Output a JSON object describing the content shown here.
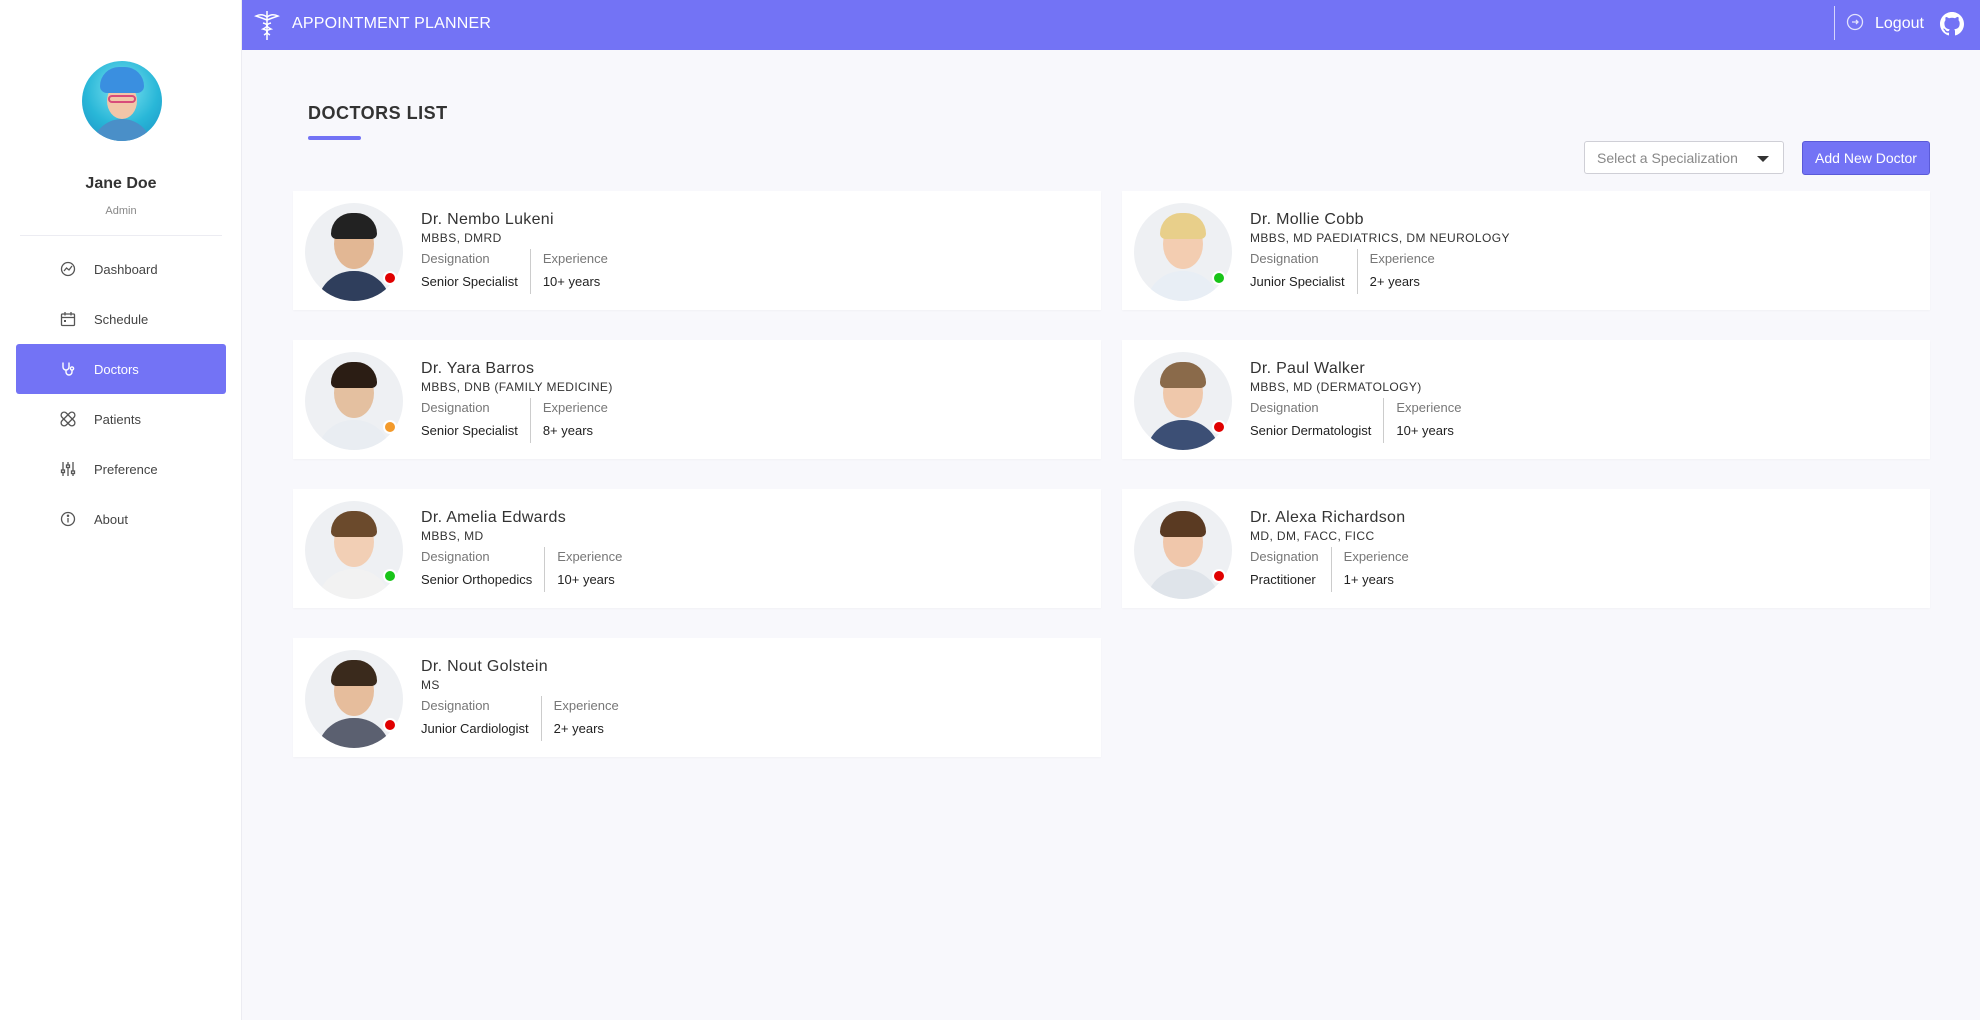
{
  "app": {
    "title": "APPOINTMENT PLANNER",
    "logout_label": "Logout"
  },
  "user": {
    "name": "Jane Doe",
    "role": "Admin"
  },
  "sidebar": {
    "items": [
      {
        "label": "Dashboard",
        "icon": "dashboard-icon",
        "active": false
      },
      {
        "label": "Schedule",
        "icon": "calendar-icon",
        "active": false
      },
      {
        "label": "Doctors",
        "icon": "stethoscope-icon",
        "active": true
      },
      {
        "label": "Patients",
        "icon": "bandage-icon",
        "active": false
      },
      {
        "label": "Preference",
        "icon": "sliders-icon",
        "active": false
      },
      {
        "label": "About",
        "icon": "info-icon",
        "active": false
      }
    ]
  },
  "main": {
    "heading": "DOCTORS LIST",
    "filter": {
      "placeholder": "Select a Specialization"
    },
    "add_button_label": "Add New Doctor",
    "labels": {
      "designation": "Designation",
      "experience": "Experience"
    }
  },
  "doctors": [
    {
      "name": "Dr. Nembo Lukeni",
      "qualification": "MBBS, DMRD",
      "designation": "Senior Specialist",
      "experience": "10+ years",
      "status_color": "#e00000"
    },
    {
      "name": "Dr. Mollie Cobb",
      "qualification": "MBBS, MD PAEDIATRICS, DM NEUROLOGY",
      "designation": "Junior Specialist",
      "experience": "2+ years",
      "status_color": "#18c418"
    },
    {
      "name": "Dr. Yara Barros",
      "qualification": "MBBS, DNB (FAMILY MEDICINE)",
      "designation": "Senior Specialist",
      "experience": "8+ years",
      "status_color": "#f39a2b"
    },
    {
      "name": "Dr. Paul Walker",
      "qualification": "MBBS, MD (DERMATOLOGY)",
      "designation": "Senior Dermatologist",
      "experience": "10+ years",
      "status_color": "#e00000"
    },
    {
      "name": "Dr. Amelia Edwards",
      "qualification": "MBBS, MD",
      "designation": "Senior Orthopedics",
      "experience": "10+ years",
      "status_color": "#18c418"
    },
    {
      "name": "Dr. Alexa Richardson",
      "qualification": "MD, DM, FACC, FICC",
      "designation": "Practitioner",
      "experience": "1+ years",
      "status_color": "#e00000"
    },
    {
      "name": "Dr. Nout Golstein",
      "qualification": "MS",
      "designation": "Junior Cardiologist",
      "experience": "2+ years",
      "status_color": "#e00000"
    }
  ],
  "colors": {
    "accent": "#7373f5",
    "background": "#f8f8fc"
  }
}
